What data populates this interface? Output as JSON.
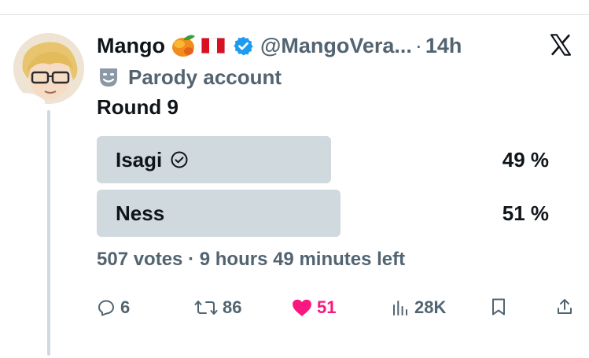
{
  "tweet": {
    "display_name": "Mango",
    "handle": "@MangoVera...",
    "separator": "·",
    "time": "14h",
    "parody_label": "Parody account",
    "text": "Round 9"
  },
  "poll": {
    "options": [
      {
        "label": "Isagi",
        "percent_text": "49 %",
        "percent": 0.49,
        "selected": true
      },
      {
        "label": "Ness",
        "percent_text": "51 %",
        "percent": 0.51,
        "selected": false
      }
    ],
    "meta": "507 votes · 9 hours 49 minutes left"
  },
  "actions": {
    "replies": "6",
    "reposts": "86",
    "likes": "51",
    "views": "28K"
  },
  "colors": {
    "accent": "#1d9bf0",
    "like": "#f91880",
    "muted": "#536471",
    "poll_bar": "#cfd9de"
  },
  "icons": [
    "avatar",
    "mango-emoji",
    "peru-flag-emoji",
    "verified-badge-icon",
    "x-logo-icon",
    "parody-mask-icon",
    "check-circle-icon",
    "reply-icon",
    "repost-icon",
    "heart-icon",
    "views-icon",
    "bookmark-icon",
    "share-icon"
  ]
}
